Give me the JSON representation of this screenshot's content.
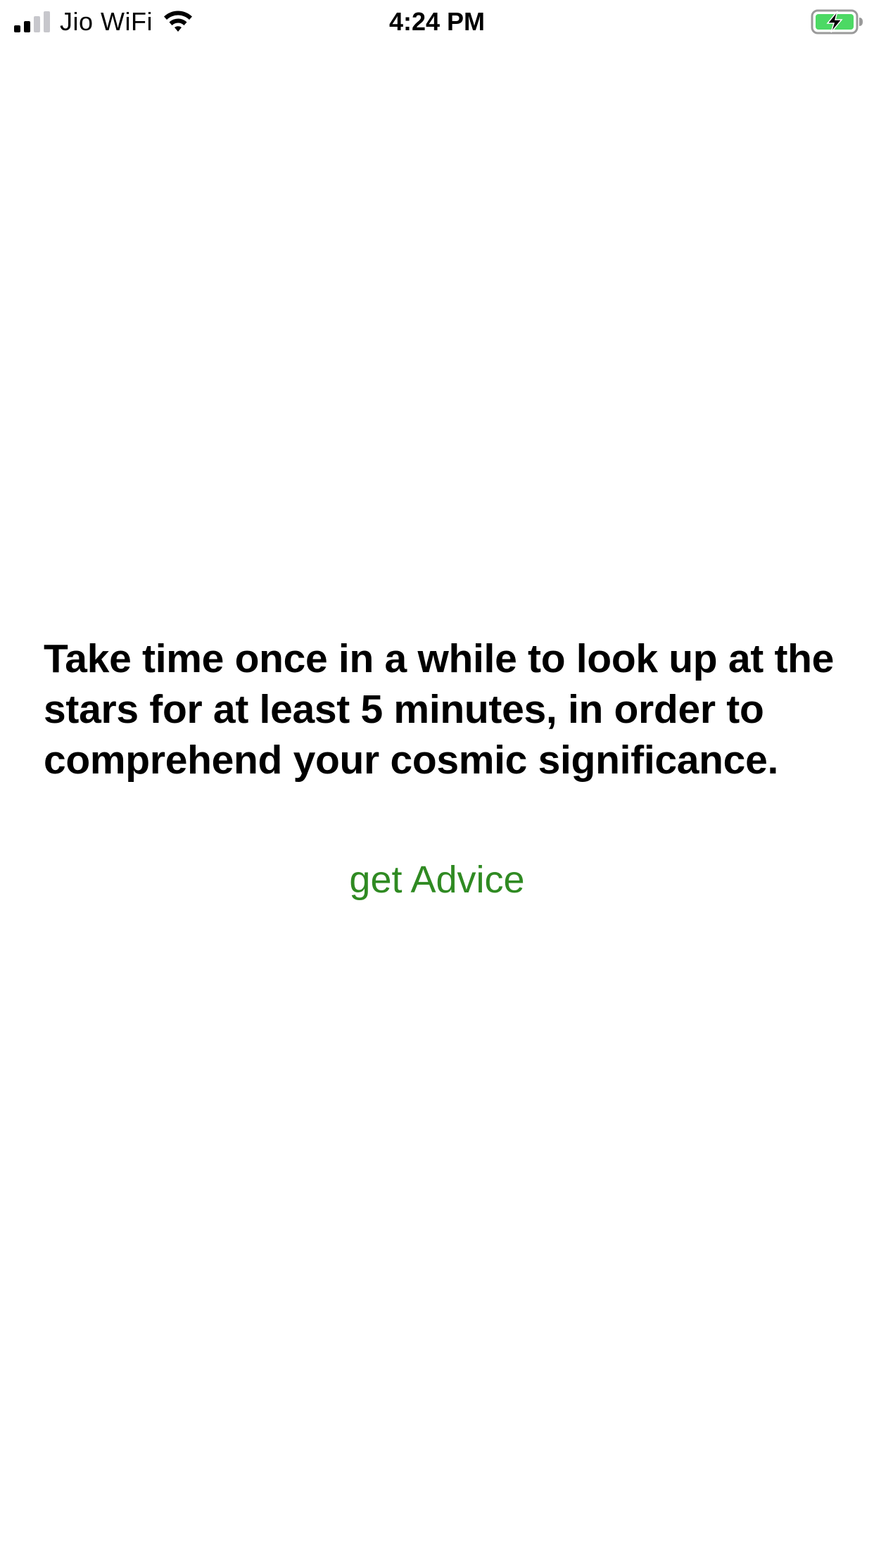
{
  "status_bar": {
    "carrier": "Jio WiFi",
    "time": "4:24 PM",
    "signal_bars_filled": 2,
    "signal_bars_total": 4,
    "icons": [
      "cellular-signal-icon",
      "wifi-icon",
      "battery-charging-icon"
    ],
    "battery_color": "#4cd964"
  },
  "main": {
    "quote": "Take time once in a while to look up at the stars for at least 5 minutes, in order to comprehend your cosmic significance.",
    "button_label": "get Advice"
  },
  "colors": {
    "background": "#ffffff",
    "text": "#000000",
    "button_text": "#2f8a22"
  }
}
